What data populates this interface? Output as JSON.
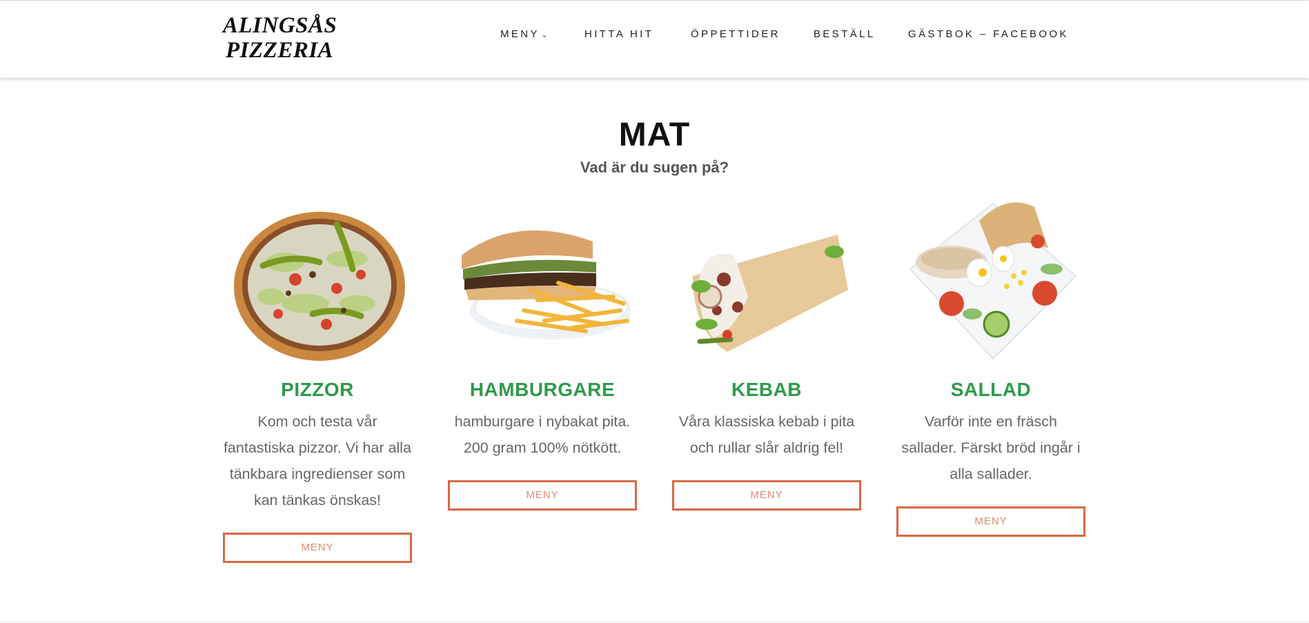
{
  "header": {
    "logo_line1": "ALINGSÅS",
    "logo_line2": "PIZZERIA",
    "nav": [
      {
        "label": "MENY",
        "has_dropdown": true
      },
      {
        "label": "HITTA HIT"
      },
      {
        "label": "ÖPPETTIDER"
      },
      {
        "label": "BESTÄLL"
      },
      {
        "label": "GÄSTBOK – FACEBOOK"
      }
    ]
  },
  "section": {
    "title": "MAT",
    "subtitle": "Vad är du sugen på?"
  },
  "cards": [
    {
      "title": "PIZZOR",
      "text": "Kom och testa vår fantastiska pizzor. Vi har alla tänkbara ingredienser som kan tänkas önskas!",
      "button": "MENY",
      "image": "pizza-image"
    },
    {
      "title": "HAMBURGARE",
      "text": "hamburgare i nybakat pita. 200 gram 100% nötkött.",
      "button": "MENY",
      "image": "hamburger-image"
    },
    {
      "title": "KEBAB",
      "text": "Våra klassiska kebab i pita och rullar slår aldrig fel!",
      "button": "MENY",
      "image": "kebab-image"
    },
    {
      "title": "SALLAD",
      "text": "Varför inte en fräsch sallader. Färskt bröd ingår i alla sallader.",
      "button": "MENY",
      "image": "salad-image"
    }
  ],
  "colors": {
    "accent_green": "#2e9a4b",
    "button_border": "#d9683f",
    "button_text": "#e0896a"
  }
}
